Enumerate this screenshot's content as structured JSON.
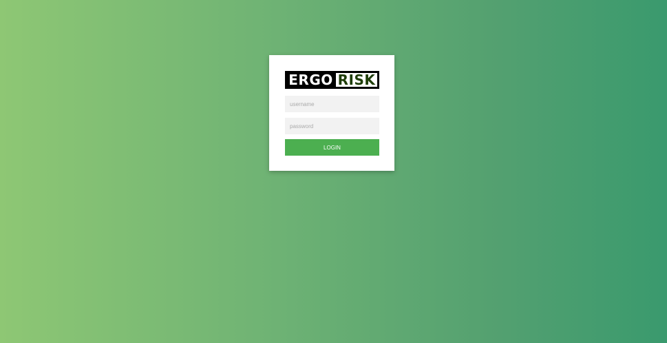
{
  "logo": {
    "part1": "ERGO",
    "part2": "RISK"
  },
  "form": {
    "username_placeholder": "username",
    "username_value": "",
    "password_placeholder": "password",
    "password_value": "",
    "login_label": "LOGIN"
  },
  "colors": {
    "background_start": "#8ec774",
    "background_end": "#3a9a6e",
    "button": "#4caf50",
    "input_bg": "#f2f2f2"
  }
}
